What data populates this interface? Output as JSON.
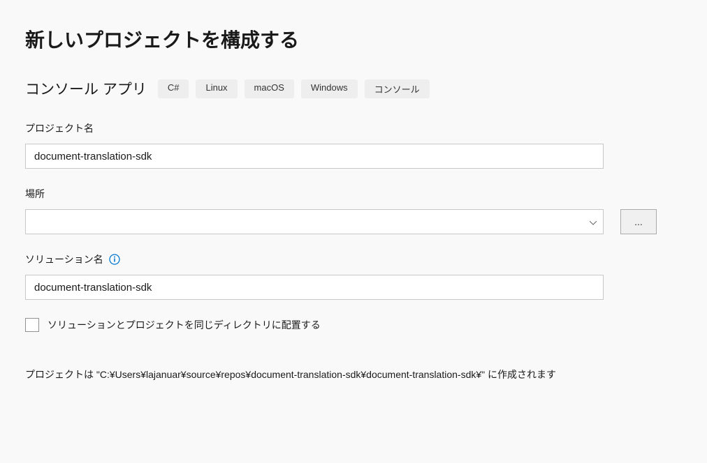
{
  "page_title": "新しいプロジェクトを構成する",
  "subtitle": "コンソール アプリ",
  "tags": [
    "C#",
    "Linux",
    "macOS",
    "Windows",
    "コンソール"
  ],
  "project_name": {
    "label": "プロジェクト名",
    "value": "document-translation-sdk"
  },
  "location": {
    "label": "場所",
    "value": "",
    "browse_label": "..."
  },
  "solution_name": {
    "label": "ソリューション名",
    "value": "document-translation-sdk"
  },
  "same_directory": {
    "label": "ソリューションとプロジェクトを同じディレクトリに配置する",
    "checked": false
  },
  "path_preview": "プロジェクトは \"C:¥Users¥lajanuar¥source¥repos¥document-translation-sdk¥document-translation-sdk¥\" に作成されます"
}
